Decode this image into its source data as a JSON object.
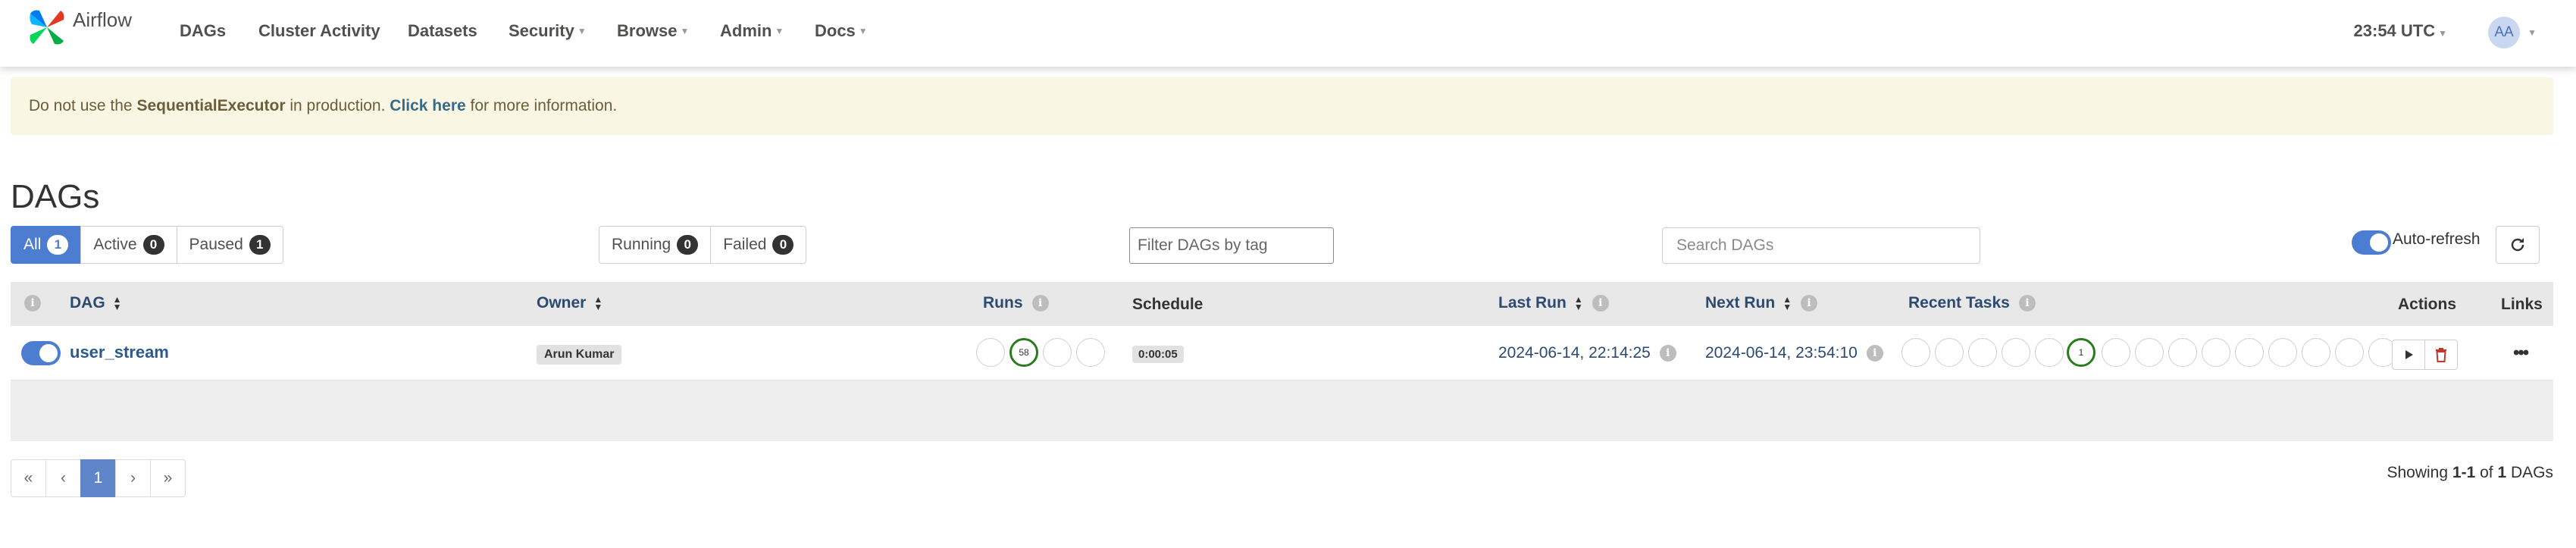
{
  "navbar": {
    "brand": "Airflow",
    "items": [
      "DAGs",
      "Cluster Activity",
      "Datasets",
      "Security",
      "Browse",
      "Admin",
      "Docs"
    ],
    "time": "23:54 UTC",
    "avatar": "AA"
  },
  "alert": {
    "prefix": "Do not use the",
    "executor": "SequentialExecutor",
    "middle": "in production.",
    "link": "Click here",
    "suffix": "for more information."
  },
  "page_title": "DAGs",
  "filters": {
    "all": {
      "label": "All",
      "count": "1"
    },
    "active": {
      "label": "Active",
      "count": "0"
    },
    "paused": {
      "label": "Paused",
      "count": "1"
    },
    "running": {
      "label": "Running",
      "count": "0"
    },
    "failed": {
      "label": "Failed",
      "count": "0"
    }
  },
  "tag_filter_placeholder": "Filter DAGs by tag",
  "search_placeholder": "Search DAGs",
  "auto_refresh_label": "Auto-refresh",
  "table": {
    "headers": {
      "dag": "DAG",
      "owner": "Owner",
      "runs": "Runs",
      "schedule": "Schedule",
      "last_run": "Last Run",
      "next_run": "Next Run",
      "recent_tasks": "Recent Tasks",
      "actions": "Actions",
      "links": "Links"
    },
    "rows": [
      {
        "dag_id": "user_stream",
        "owner": "Arun Kumar",
        "runs_success": "58",
        "schedule": "0:00:05",
        "last_run": "2024-06-14, 22:14:25",
        "next_run": "2024-06-14, 23:54:10",
        "recent_tasks_success": "1"
      }
    ]
  },
  "pagination": {
    "first": "«",
    "prev": "‹",
    "current": "1",
    "next": "›",
    "last": "»"
  },
  "showing": {
    "prefix": "Showing",
    "range": "1-1",
    "of": "of",
    "total": "1",
    "suffix": "DAGs"
  },
  "colors": {
    "accent": "#4d7dd1",
    "success": "#2a7a1e",
    "delete": "#c0392b"
  }
}
